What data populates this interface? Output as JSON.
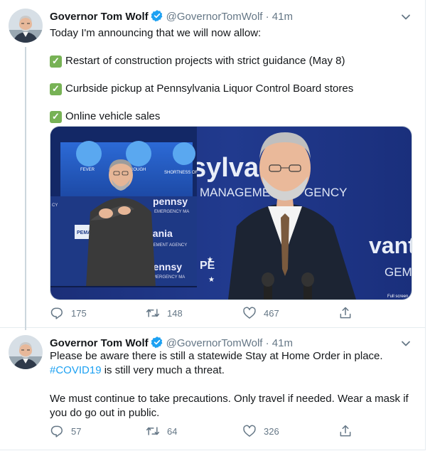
{
  "tweets": [
    {
      "author_name": "Governor Tom Wolf",
      "handle": "@GovernorTomWolf",
      "separator": "·",
      "time": "41m",
      "intro": "Today I'm announcing that we will now allow:",
      "items": [
        "Restart of construction projects with strict guidance (May 8)",
        "Curbside pickup at Pennsylvania Liquor Control Board stores",
        "Online vehicle sales"
      ],
      "check_mark": "✓",
      "media": {
        "slide_labels": [
          "FEVER",
          "COUGH",
          "SHORTNESS OF"
        ],
        "backdrop_text": [
          "sylva",
          "MANAGEMENT",
          "GENCY",
          "pennsy",
          "EMERGENCY MA",
          "vania",
          "AGEMENT AGENCY",
          "pennsy",
          "EMERGENCY MA",
          "vant",
          "GEMEI",
          "PEMA",
          "PE",
          "CY"
        ],
        "fullscreen_label": "Full screen"
      },
      "actions": {
        "replies": "175",
        "retweets": "148",
        "likes": "467"
      }
    },
    {
      "author_name": "Governor Tom Wolf",
      "handle": "@GovernorTomWolf",
      "separator": "·",
      "time": "41m",
      "line1": "Please be aware there is still a statewide Stay at Home Order in place.",
      "hashtag": "#COVID19",
      "line2_rest": " is still very much a threat.",
      "paragraph2": "We must continue to take precautions. Only travel if needed. Wear a mask if you do go out in public.",
      "actions": {
        "replies": "57",
        "retweets": "64",
        "likes": "326"
      }
    }
  ],
  "colors": {
    "accent": "#1da1f2",
    "check_green": "#77b255",
    "muted": "#657786",
    "podium_blue": "#123f96"
  }
}
